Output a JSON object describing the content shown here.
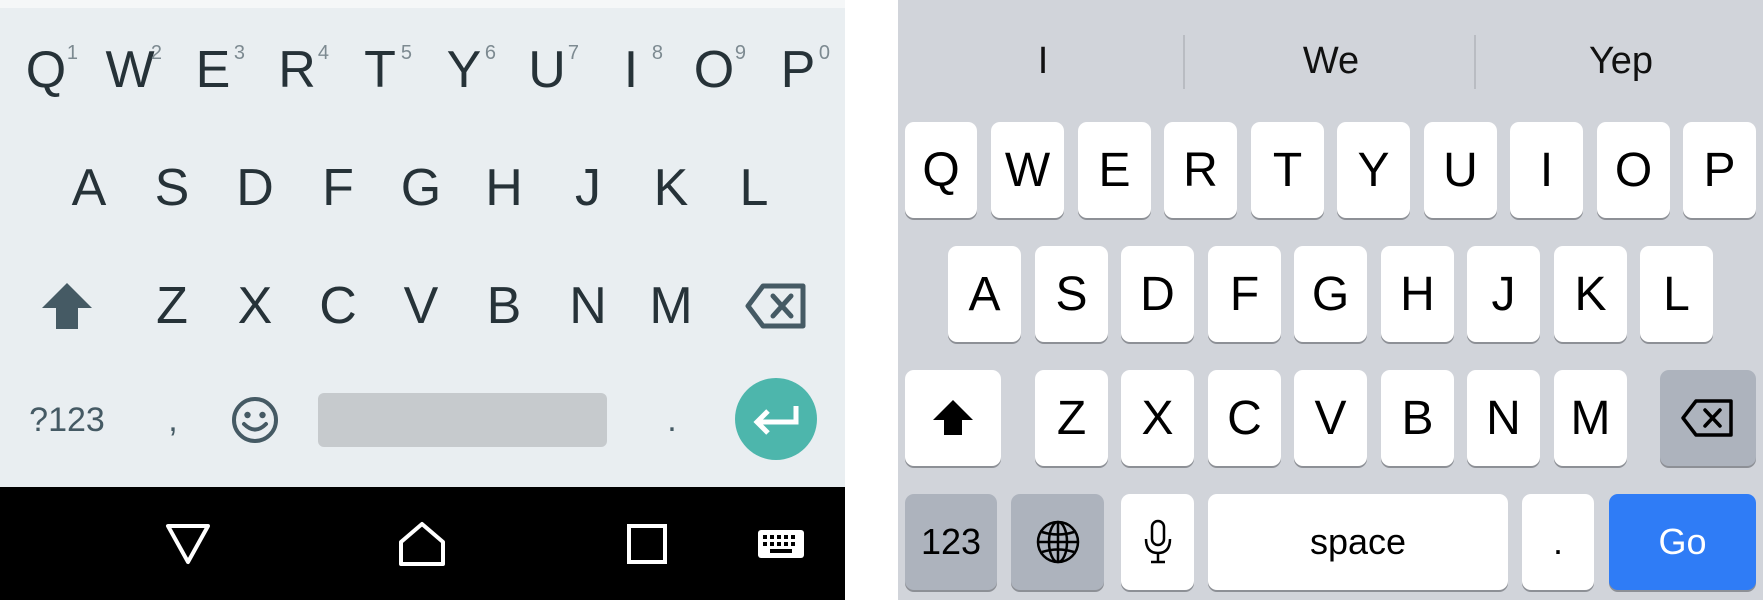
{
  "android": {
    "row1": [
      {
        "letter": "Q",
        "hint": "1"
      },
      {
        "letter": "W",
        "hint": "2"
      },
      {
        "letter": "E",
        "hint": "3"
      },
      {
        "letter": "R",
        "hint": "4"
      },
      {
        "letter": "T",
        "hint": "5"
      },
      {
        "letter": "Y",
        "hint": "6"
      },
      {
        "letter": "U",
        "hint": "7"
      },
      {
        "letter": "I",
        "hint": "8"
      },
      {
        "letter": "O",
        "hint": "9"
      },
      {
        "letter": "P",
        "hint": "0"
      }
    ],
    "row2": [
      "A",
      "S",
      "D",
      "F",
      "G",
      "H",
      "J",
      "K",
      "L"
    ],
    "row3": [
      "Z",
      "X",
      "C",
      "V",
      "B",
      "N",
      "M"
    ],
    "symbols_label": "?123",
    "comma_label": ",",
    "period_label": ".",
    "icons": {
      "shift": "shift-arrow-icon",
      "backspace": "backspace-icon",
      "emoji": "emoji-icon",
      "enter": "enter-return-icon",
      "back": "back-triangle-icon",
      "home": "home-icon",
      "recents": "recents-square-icon",
      "keyboard": "keyboard-icon"
    },
    "colors": {
      "background": "#e9eef1",
      "enter": "#4db6ac",
      "nav_bar": "#000000"
    }
  },
  "ios": {
    "suggestions": [
      "I",
      "We",
      "Yep"
    ],
    "row1": [
      "Q",
      "W",
      "E",
      "R",
      "T",
      "Y",
      "U",
      "I",
      "O",
      "P"
    ],
    "row2": [
      "A",
      "S",
      "D",
      "F",
      "G",
      "H",
      "J",
      "K",
      "L"
    ],
    "row3": [
      "Z",
      "X",
      "C",
      "V",
      "B",
      "N",
      "M"
    ],
    "numbers_label": "123",
    "space_label": "space",
    "period_label": ".",
    "go_label": "Go",
    "icons": {
      "shift": "shift-arrow-icon",
      "backspace": "backspace-icon",
      "globe": "globe-icon",
      "mic": "microphone-icon"
    },
    "colors": {
      "background": "#d1d4da",
      "go": "#2f7cf6"
    }
  }
}
